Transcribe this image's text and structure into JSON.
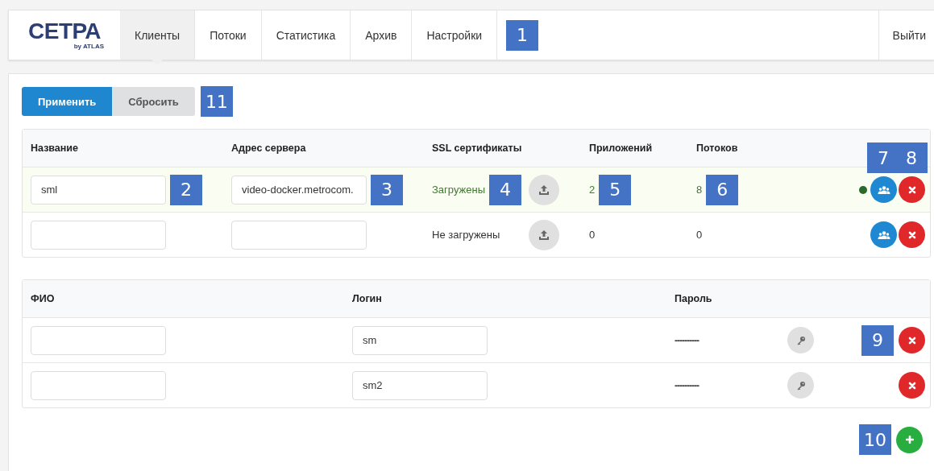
{
  "nav": {
    "logo": {
      "title": "СЕТРА",
      "subtitle": "by ATLAS"
    },
    "tabs": [
      {
        "label": "Клиенты",
        "selected": true
      },
      {
        "label": "Потоки",
        "selected": false
      },
      {
        "label": "Статистика",
        "selected": false
      },
      {
        "label": "Архив",
        "selected": false
      },
      {
        "label": "Настройки",
        "selected": false
      }
    ],
    "callout": "1",
    "logout": "Выйти"
  },
  "toolbar": {
    "buttons": [
      {
        "label": "Применить",
        "kind": "primary"
      },
      {
        "label": "Сбросить",
        "kind": "secondary"
      }
    ],
    "callout": "11"
  },
  "clients": {
    "columns": [
      "Название",
      "Адрес сервера",
      "SSL сертификаты",
      "Приложений",
      "Потоков"
    ],
    "rows": [
      {
        "active": true,
        "name": "sml",
        "server": "video-docker.metrocom.",
        "ssl": "Загружены",
        "apps": "2",
        "streams": "8",
        "callouts": {
          "name": "2",
          "server": "3",
          "ssl": "4",
          "apps": "5",
          "streams": "6",
          "group": "7",
          "delete": "8"
        }
      },
      {
        "active": false,
        "ssl": "Не загружены",
        "apps": "0",
        "streams": "0"
      }
    ]
  },
  "users": {
    "columns": [
      "ФИО",
      "Логин",
      "Пароль"
    ],
    "rows": [
      {
        "login": "sm",
        "password": "----------",
        "callouts": {
          "delete": "9"
        }
      },
      {
        "login": "sm2",
        "password": "----------"
      }
    ],
    "add_callout": "10"
  }
}
